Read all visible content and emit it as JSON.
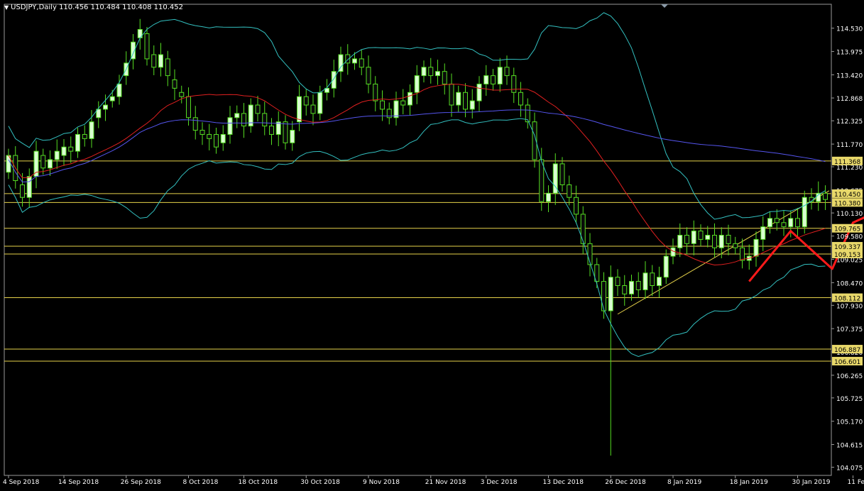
{
  "header": {
    "symbol": "USDJPY,Daily",
    "ohlc": "110.456 110.484 110.408 110.452"
  },
  "chart_data": {
    "type": "candlestick",
    "symbol": "USDJPY",
    "timeframe": "Daily",
    "ylim": [
      103.88,
      115.1
    ],
    "y_ticks": [
      "114.530",
      "113.975",
      "113.420",
      "112.868",
      "112.325",
      "111.770",
      "111.230",
      "110.675",
      "110.130",
      "109.580",
      "109.025",
      "108.470",
      "107.930",
      "107.375",
      "106.820",
      "106.265",
      "105.725",
      "105.170",
      "104.615",
      "104.075"
    ],
    "x_ticks": [
      "4 Sep 2018",
      "14 Sep 2018",
      "26 Sep 2018",
      "8 Oct 2018",
      "18 Oct 2018",
      "30 Oct 2018",
      "9 Nov 2018",
      "21 Nov 2018",
      "3 Dec 2018",
      "13 Dec 2018",
      "26 Dec 2018",
      "8 Jan 2019",
      "18 Jan 2019",
      "30 Jan 2019",
      "11 Feb 2019"
    ],
    "x_tick_index": [
      0,
      8,
      17,
      26,
      34,
      43,
      52,
      61,
      69,
      78,
      87,
      96,
      105,
      114,
      122
    ],
    "candles_open_close": [
      [
        111.1,
        111.5
      ],
      [
        111.5,
        110.9
      ],
      [
        110.8,
        110.5
      ],
      [
        110.5,
        111.0
      ],
      [
        111.0,
        111.6
      ],
      [
        111.5,
        111.2
      ],
      [
        111.2,
        111.4
      ],
      [
        111.4,
        111.6
      ],
      [
        111.5,
        111.7
      ],
      [
        111.7,
        111.6
      ],
      [
        111.6,
        112.0
      ],
      [
        112.0,
        111.9
      ],
      [
        111.9,
        112.3
      ],
      [
        112.4,
        112.6
      ],
      [
        112.6,
        112.7
      ],
      [
        112.8,
        112.9
      ],
      [
        112.9,
        113.2
      ],
      [
        113.4,
        113.7
      ],
      [
        113.8,
        114.2
      ],
      [
        114.3,
        114.5
      ],
      [
        114.4,
        113.8
      ],
      [
        113.9,
        113.6
      ],
      [
        113.6,
        113.9
      ],
      [
        113.8,
        113.4
      ],
      [
        113.3,
        113.1
      ],
      [
        113.0,
        112.9
      ],
      [
        112.9,
        112.4
      ],
      [
        112.4,
        112.1
      ],
      [
        112.1,
        112.0
      ],
      [
        112.0,
        111.9
      ],
      [
        112.0,
        111.7
      ],
      [
        111.8,
        112.0
      ],
      [
        112.0,
        112.4
      ],
      [
        112.4,
        112.5
      ],
      [
        112.5,
        112.2
      ],
      [
        112.2,
        112.7
      ],
      [
        112.7,
        112.5
      ],
      [
        112.5,
        112.2
      ],
      [
        112.2,
        112.0
      ],
      [
        112.0,
        112.3
      ],
      [
        112.3,
        111.8
      ],
      [
        111.8,
        112.1
      ],
      [
        112.3,
        112.9
      ],
      [
        112.9,
        112.7
      ],
      [
        112.7,
        112.5
      ],
      [
        112.5,
        113.0
      ],
      [
        113.0,
        113.1
      ],
      [
        113.1,
        113.5
      ],
      [
        113.5,
        113.9
      ],
      [
        113.9,
        113.7
      ],
      [
        113.7,
        113.8
      ],
      [
        113.8,
        113.6
      ],
      [
        113.6,
        113.2
      ],
      [
        113.2,
        112.8
      ],
      [
        112.8,
        112.6
      ],
      [
        112.6,
        112.4
      ],
      [
        112.4,
        112.8
      ],
      [
        112.8,
        112.7
      ],
      [
        112.7,
        113.0
      ],
      [
        113.0,
        113.4
      ],
      [
        113.4,
        113.6
      ],
      [
        113.6,
        113.4
      ],
      [
        113.4,
        113.5
      ],
      [
        113.5,
        113.2
      ],
      [
        113.2,
        112.7
      ],
      [
        112.7,
        113.0
      ],
      [
        113.0,
        112.6
      ],
      [
        112.6,
        112.8
      ],
      [
        112.8,
        113.2
      ],
      [
        113.2,
        113.4
      ],
      [
        113.4,
        113.2
      ],
      [
        113.2,
        113.6
      ],
      [
        113.6,
        113.4
      ],
      [
        113.4,
        113.0
      ],
      [
        113.0,
        112.7
      ],
      [
        112.7,
        112.3
      ],
      [
        112.3,
        111.4
      ],
      [
        111.4,
        110.4
      ],
      [
        110.4,
        110.6
      ],
      [
        110.6,
        111.3
      ],
      [
        111.3,
        110.8
      ],
      [
        110.8,
        110.5
      ],
      [
        110.5,
        110.1
      ],
      [
        110.1,
        109.4
      ],
      [
        109.4,
        108.9
      ],
      [
        108.9,
        108.5
      ],
      [
        108.5,
        107.8
      ],
      [
        107.8,
        108.6
      ],
      [
        108.6,
        108.4
      ],
      [
        108.4,
        108.2
      ],
      [
        108.2,
        108.5
      ],
      [
        108.5,
        108.3
      ],
      [
        108.3,
        108.7
      ],
      [
        108.7,
        108.4
      ],
      [
        108.4,
        108.6
      ],
      [
        108.6,
        109.1
      ],
      [
        109.1,
        109.3
      ],
      [
        109.3,
        109.6
      ],
      [
        109.6,
        109.4
      ],
      [
        109.4,
        109.7
      ],
      [
        109.7,
        109.5
      ],
      [
        109.5,
        109.6
      ],
      [
        109.6,
        109.3
      ],
      [
        109.3,
        109.6
      ],
      [
        109.6,
        109.4
      ],
      [
        109.4,
        109.3
      ],
      [
        109.3,
        109.0
      ],
      [
        109.0,
        109.1
      ],
      [
        109.1,
        109.5
      ],
      [
        109.5,
        109.8
      ],
      [
        109.8,
        110.0
      ],
      [
        110.0,
        109.9
      ],
      [
        109.9,
        109.8
      ],
      [
        109.8,
        110.0
      ],
      [
        110.0,
        109.8
      ],
      [
        109.8,
        110.5
      ],
      [
        110.5,
        110.4
      ],
      [
        110.4,
        110.6
      ],
      [
        110.6,
        110.45
      ]
    ],
    "horizontal_levels": [
      "111.368",
      "110.590",
      "110.380",
      "109.765",
      "109.337",
      "109.153",
      "108.112",
      "106.887",
      "106.601"
    ],
    "axis_price_labels": [
      "111.368",
      "110.450",
      "110.380",
      "109.765",
      "109.337",
      "109.153",
      "108.112",
      "106.887",
      "106.601"
    ]
  },
  "colors": {
    "background": "#000000",
    "candle_bull": "#d8ffd0",
    "candle_bear": "#0a0a0a",
    "wick": "#55dd22",
    "bands": "#33c0c0",
    "middle_band": "#e02020",
    "moving_average": "#5555ee",
    "levels": "#e6d24a",
    "trendline": "#e6d24a",
    "annotation": "#ff1a1a",
    "axis_text": "#ffffff",
    "border": "#9a9a9a"
  }
}
